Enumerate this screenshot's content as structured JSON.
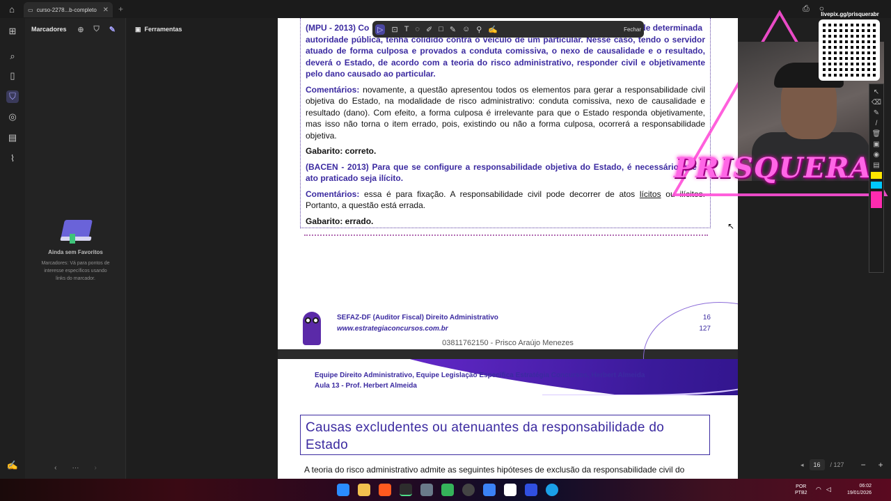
{
  "titlebar": {
    "tab_title": "curso-2278...b-completo"
  },
  "sidebar": {
    "title": "Marcadores",
    "empty_title": "Ainda sem Favoritos",
    "empty_desc": "Marcadores: Vá para pontos de interesse específicos usando links do marcador."
  },
  "tools": {
    "title": "Ferramentas"
  },
  "annotation_toolbar": {
    "close_label": "Fechar"
  },
  "page1": {
    "q1_prefix": "(MPU - 2013) Co",
    "q1_line1_end": "de determinada",
    "q1_rest": "autoridade pública, tenha colidido contra o veículo de um particular. Nesse caso, tendo o servidor atuado de forma culposa e provados a conduta comissiva, o nexo de causalidade e o resultado, deverá o Estado, de acordo com a teoria do risco administrativo, responder civil e objetivamente pelo dano causado ao particular.",
    "c1_label": "Comentários:",
    "c1_text": " novamente, a questão apresentou todos os elementos para gerar a responsabilidade civil objetiva do Estado, na modalidade de risco administrativo: conduta comissiva, nexo de causalidade e resultado (dano). Com efeito, a forma culposa é irrelevante para que o Estado responda objetivamente, mas isso não torna o item errado, pois, existindo ou não a forma culposa, ocorrerá a responsabilidade objetiva.",
    "g1": "Gabarito: correto.",
    "q2": "(BACEN - 2013) Para que se configure a responsabilidade objetiva do Estado, é necessário que o ato praticado seja ilícito.",
    "c2_label": "Comentários:",
    "c2_a": " essa é para fixação. A responsabilidade civil pode decorrer de atos ",
    "c2_u": "lícitos",
    "c2_b": " ou ilícitos. Portanto, a questão está errada.",
    "g2": "Gabarito: errado.",
    "footer_title": "SEFAZ-DF (Auditor Fiscal) Direito Administrativo",
    "footer_url": "www.estrategiaconcursos.com.br",
    "page_num": "16",
    "page_total": "127",
    "footer_name": "03811762150 - Prisco Araújo Menezes"
  },
  "page2": {
    "banner_line1": "Equipe Direito Administrativo, Equipe Legislação Específica Estratégia Concursos, Herbert Almeida",
    "banner_line2": "Aula 13 - Prof. Herbert Almeida",
    "heading": "Causas excludentes ou atenuantes da responsabilidade do Estado",
    "para": "A teoria do risco administrativo admite as seguintes hipóteses de exclusão da responsabilidade civil do"
  },
  "page_nav": {
    "current": "16",
    "total": "/ 127"
  },
  "overlay": {
    "brand": "PRISQUERA",
    "qr_url": "livepix.gg/prisquerabr"
  },
  "taskbar": {
    "lang1": "POR",
    "lang2": "PTB2",
    "time": "06:02",
    "date": "19/01/2026"
  },
  "colors": {
    "accent": "#3b2aa0",
    "brand_pink": "#ff66e6"
  }
}
